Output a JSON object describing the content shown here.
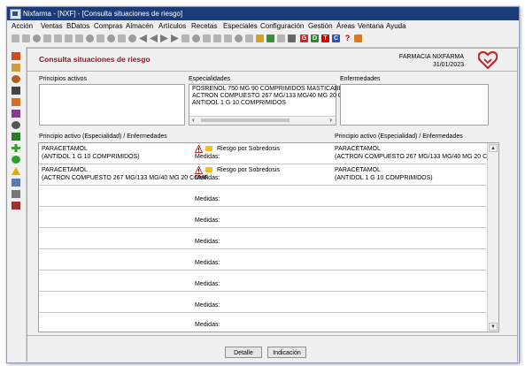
{
  "window": {
    "title": "Nixfarma - [NXF] - [Consulta situaciones de riesgo]"
  },
  "menu": {
    "items": [
      "Acción",
      "Ventas",
      "BDatos",
      "Compras",
      "Almacén",
      "Artículos",
      "Recetas",
      "Especiales",
      "Configuración",
      "Gestión",
      "Áreas",
      "Ventana",
      "Ayuda"
    ]
  },
  "toolbar": {
    "icons": [
      "new-icon",
      "save-icon",
      "edit-icon",
      "folder-icon",
      "copy-icon",
      "paste-icon",
      "print-icon",
      "preview-icon",
      "cut-icon",
      "find-icon",
      "filter-icon",
      "favorite-icon",
      "first-icon",
      "prev-icon",
      "next-icon",
      "last-icon",
      "back-icon",
      "refresh-icon",
      "tools-icon",
      "calculator-icon",
      "camera-icon",
      "key-icon",
      "stack-icon",
      "grid-icon",
      "chart-icon",
      "link-icon"
    ],
    "colored_buttons": [
      {
        "label": "G",
        "color": "#e02020"
      },
      {
        "label": "D",
        "color": "#2a8a2a"
      },
      {
        "label": "T",
        "color": "#d00000"
      },
      {
        "label": "C",
        "color": "#2a4fc8"
      }
    ],
    "help_label": "?"
  },
  "sidebar": {
    "icons": [
      "sales-icon",
      "wallet-icon",
      "user-icon",
      "cart-icon",
      "stock-icon",
      "pill-icon",
      "link-icon",
      "list-icon",
      "add-icon",
      "refresh-icon",
      "alert-icon",
      "people-icon",
      "table-icon",
      "stats-icon"
    ]
  },
  "header": {
    "title": "Consulta situaciones de riesgo",
    "pharmacy": "FARMACIA NIXFARMA",
    "date": "31/01/2023"
  },
  "filters": {
    "principios_label": "Principios activos",
    "especialidades_label": "Especialidades",
    "enfermedades_label": "Enfermedades",
    "especialidades": [
      "FOSRENOL 750 MG 90 COMPRIMIDOS MASTICABLES",
      "ACTRON COMPUESTO 267 MG/133 MG/40 MG 20 COMF",
      "ANTIDOL 1 G 10 COMPRIMIDOS"
    ],
    "scroll_left": "‹",
    "scroll_right": "›"
  },
  "grid": {
    "col_left": "Principio activo (Especialidad) / Enfermedades",
    "col_right": "Principio activo (Especialidad) / Enfermedades",
    "medidas_label": "Medidas:",
    "rows": [
      {
        "left_1": "PARACETAMOL",
        "left_2": "(ANTIDOL 1 G 10 COMPRIMIDOS)",
        "risk": "Riesgo por Sobredosis",
        "right_1": "PARACETAMOL",
        "right_2": "(ACTRON COMPUESTO 267 MG/133 MG/40 MG 20 COMF"
      },
      {
        "left_1": "PARACETAMOL",
        "left_2": "(ACTRON COMPUESTO 267 MG/133 MG/40 MG 20 COMF",
        "risk": "Riesgo por Sobredosis",
        "right_1": "PARACETAMOL",
        "right_2": "(ANTIDOL 1 G 10 COMPRIMIDOS)"
      }
    ],
    "scroll_up": "▲",
    "scroll_down": "▼"
  },
  "footer": {
    "detalle_label": "Detalle",
    "indicacion_label": "Indicación"
  }
}
